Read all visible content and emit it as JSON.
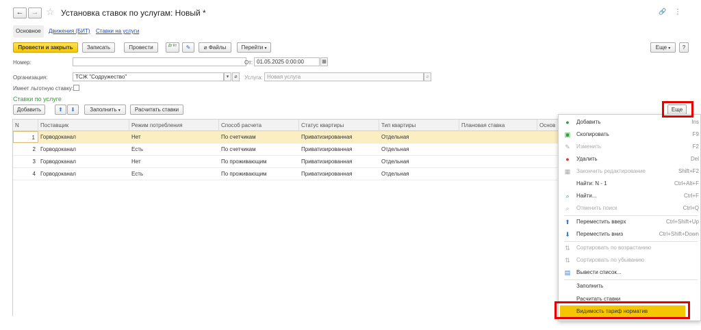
{
  "header": {
    "back": "←",
    "forward": "→",
    "title": "Установка ставок по услугам: Новый *",
    "link_icon": "🔗",
    "more_icon": "⋮"
  },
  "tabs": [
    {
      "label": "Основное"
    },
    {
      "label": "Движения (БИТ)"
    },
    {
      "label": "Ставки на услуги"
    }
  ],
  "toolbar": {
    "post_close": "Провести и закрыть",
    "save": "Записать",
    "post": "Провести",
    "dt_kt": "Дт Кт",
    "files": "Файлы",
    "goto": "Перейти",
    "more": "Еще",
    "help": "?"
  },
  "form": {
    "number_label": "Номер:",
    "number_value": "",
    "from_label": "От:",
    "date_value": "01.05.2025  0:00:00",
    "org_label": "Организация:",
    "org_value": "ТСЖ \"Содружество\"",
    "service_label": "Услуга:",
    "service_placeholder": "Новая услуга",
    "benefit_label": "Имеет льготную ставку:"
  },
  "section": {
    "title": "Ставки по услуге",
    "add": "Добавить",
    "up": "⬆",
    "down": "⬇",
    "fill": "Заполнить",
    "calc": "Расчитать ставки",
    "more": "Еще"
  },
  "table": {
    "columns": [
      "N",
      "Поставщик",
      "Режим потребления",
      "Способ расчета",
      "Статус квартиры",
      "Тип квартиры",
      "Плановая ставка",
      "Основ"
    ],
    "rows": [
      [
        "1",
        "Горводоканал",
        "Нет",
        "По счетчикам",
        "Приватизированная",
        "Отдельная",
        "",
        ""
      ],
      [
        "2",
        "Горводоканал",
        "Есть",
        "По счетчикам",
        "Приватизированная",
        "Отдельная",
        "",
        ""
      ],
      [
        "3",
        "Горводоканал",
        "Нет",
        "По проживающим",
        "Приватизированная",
        "Отдельная",
        "",
        ""
      ],
      [
        "4",
        "Горводоканал",
        "Есть",
        "По проживающим",
        "Приватизированная",
        "Отдельная",
        "",
        ""
      ]
    ]
  },
  "menu": {
    "items": [
      {
        "label": "Добавить",
        "shortcut": "Ins",
        "icon": "add-icon",
        "glyph": "●"
      },
      {
        "label": "Скопировать",
        "shortcut": "F9",
        "icon": "copy-icon",
        "glyph": "▣"
      },
      {
        "label": "Изменить",
        "shortcut": "F2",
        "icon": "pencil-icon",
        "glyph": "✎"
      },
      {
        "label": "Удалить",
        "shortcut": "Del",
        "icon": "delete-icon",
        "glyph": "●"
      },
      {
        "label": "Закончить редактирование",
        "shortcut": "Shift+F2",
        "icon": "end-edit-icon",
        "glyph": "▦"
      },
      {
        "label": "Найти: N - 1",
        "shortcut": "Ctrl+Alt+F",
        "icon": "",
        "glyph": ""
      },
      {
        "label": "Найти...",
        "shortcut": "Ctrl+F",
        "icon": "search-icon",
        "glyph": "⌕"
      },
      {
        "label": "Отменить поиск",
        "shortcut": "Ctrl+Q",
        "icon": "cancel-search-icon",
        "glyph": "⌕"
      },
      {
        "label": "Переместить вверх",
        "shortcut": "Ctrl+Shift+Up",
        "icon": "arrow-up-icon",
        "glyph": "⬆"
      },
      {
        "label": "Переместить вниз",
        "shortcut": "Ctrl+Shift+Down",
        "icon": "arrow-down-icon",
        "glyph": "⬇"
      },
      {
        "label": "Сортировать по возрастанию",
        "shortcut": "",
        "icon": "sort-asc-icon",
        "glyph": "⇅"
      },
      {
        "label": "Сортировать по убыванию",
        "shortcut": "",
        "icon": "sort-desc-icon",
        "glyph": "⇅"
      },
      {
        "label": "Вывести список...",
        "shortcut": "",
        "icon": "print-list-icon",
        "glyph": "▤"
      },
      {
        "label": "Заполнить",
        "shortcut": "",
        "icon": "",
        "glyph": ""
      },
      {
        "label": "Расчитать ставки",
        "shortcut": "",
        "icon": "",
        "glyph": ""
      },
      {
        "label": "Видимость тариф норматив",
        "shortcut": "",
        "icon": "",
        "glyph": ""
      }
    ]
  },
  "colors": {
    "accent_yellow": "#f5c700",
    "highlight_red": "#e60000",
    "link_blue": "#1f4fa8",
    "section_green": "#3a9a3a",
    "selected_row": "#fbeec3",
    "icon_green": "#2f9e3a",
    "icon_red": "#d9342b",
    "icon_blue": "#3b7bd4"
  }
}
